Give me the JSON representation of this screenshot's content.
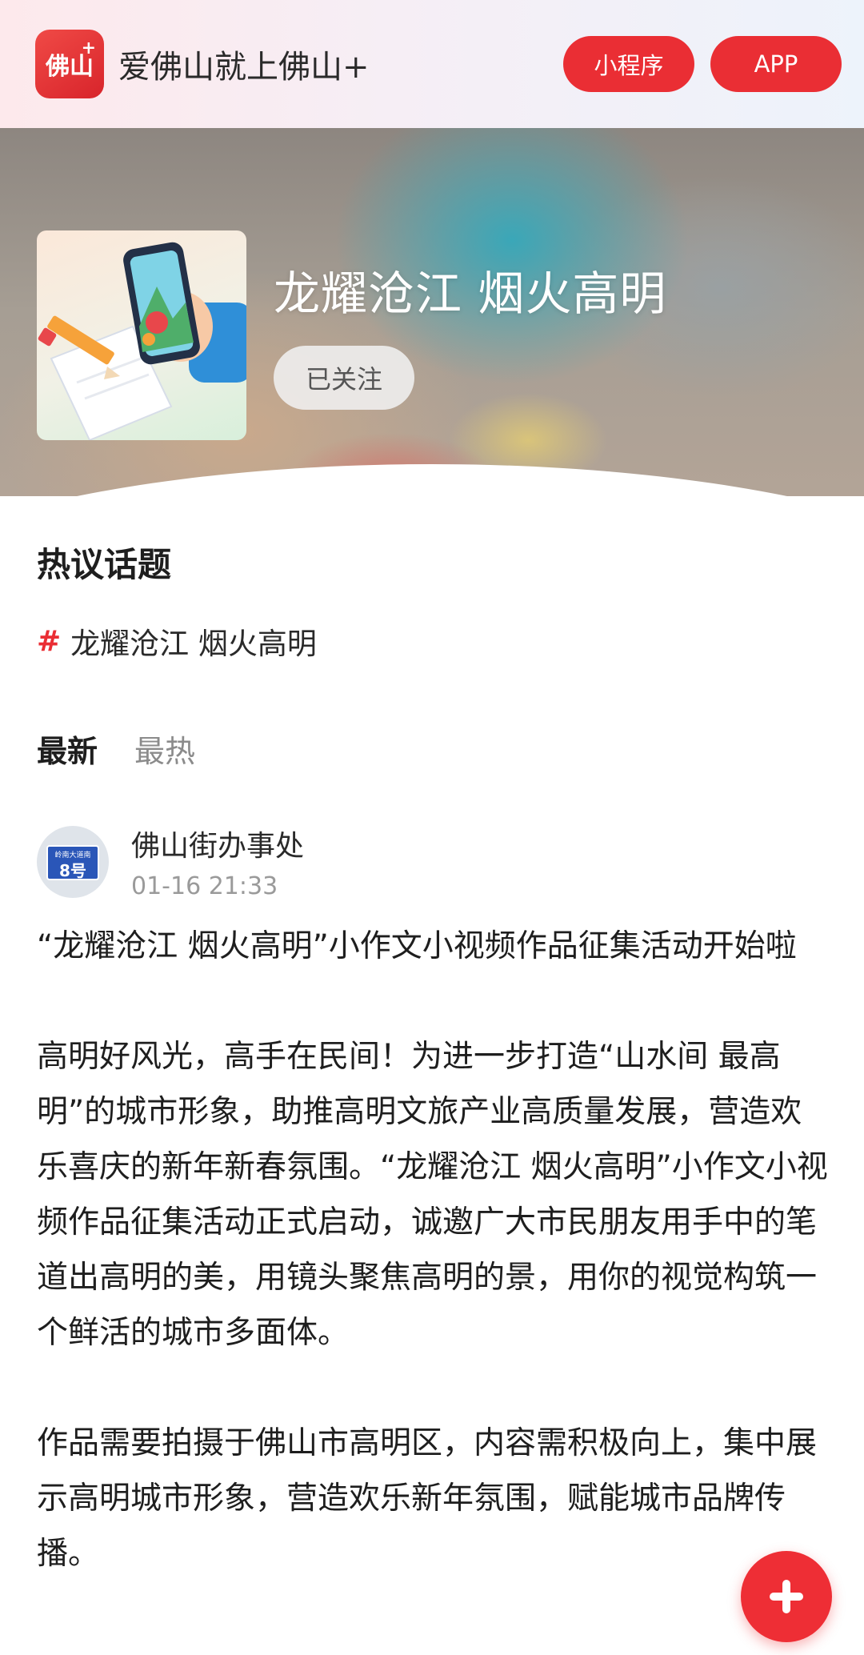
{
  "appbar": {
    "logo_text": "佛山",
    "logo_plus": "+",
    "brand": "爱佛山就上佛山+",
    "miniprogram_label": "小程序",
    "app_label": "APP"
  },
  "topic": {
    "title": "龙耀沧江 烟火高明",
    "follow_label": "已关注"
  },
  "section": {
    "hot_title": "热议话题",
    "hashtag_symbol": "#",
    "hashtag": "龙耀沧江 烟火高明"
  },
  "tabs": [
    {
      "label": "最新",
      "active": true
    },
    {
      "label": "最热",
      "active": false
    }
  ],
  "post": {
    "author": "佛山街办事处",
    "time": "01-16 21:33",
    "avatar_sign_top": "岭南大道南",
    "avatar_sign_main": "8号",
    "paragraphs": [
      " “龙耀沧江 烟火高明”小作文小视频作品征集活动开始啦",
      "高明好风光，高手在民间！为进一步打造“山水间 最高明”的城市形象，助推高明文旅产业高质量发展，营造欢乐喜庆的新年新春氛围。“龙耀沧江 烟火高明”小作文小视频作品征集活动正式启动，诚邀广大市民朋友用手中的笔道出高明的美，用镜头聚焦高明的景，用你的视觉构筑一个鲜活的城市多面体。",
      "作品需要拍摄于佛山市高明区，内容需积极向上，集中展示高明城市形象，营造欢乐新年氛围，赋能城市品牌传播。"
    ]
  },
  "icons": {
    "fab": "plus-icon",
    "hashtag": "hashtag-icon"
  },
  "colors": {
    "accent": "#ea2e34",
    "fab": "#ee2e35"
  }
}
